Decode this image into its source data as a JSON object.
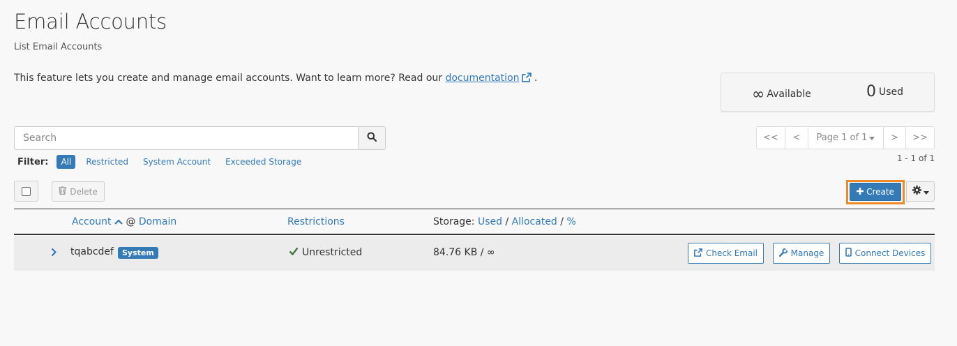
{
  "header": {
    "title": "Email Accounts",
    "subtitle": "List Email Accounts",
    "intro_text": "This feature lets you create and manage email accounts. Want to learn more? Read our ",
    "doc_link": "documentation",
    "intro_end": " ."
  },
  "stats": {
    "available_symbol": "∞",
    "available_label": "Available",
    "used_value": "0",
    "used_label": "Used"
  },
  "search": {
    "placeholder": "Search"
  },
  "filter": {
    "label": "Filter:",
    "items": [
      "All",
      "Restricted",
      "System Account",
      "Exceeded Storage"
    ],
    "active": "All"
  },
  "pagination": {
    "first": "<<",
    "prev": "<",
    "page_label": "Page 1 of 1",
    "next": ">",
    "last": ">>",
    "count": "1 - 1 of 1"
  },
  "toolbar": {
    "delete_label": "Delete",
    "create_label": "Create"
  },
  "table": {
    "headers": {
      "account": "Account",
      "at": "@",
      "domain": "Domain",
      "restrictions": "Restrictions",
      "storage_prefix": "Storage:",
      "used": "Used",
      "allocated": "Allocated",
      "percent": "%",
      "sep": "/"
    },
    "rows": [
      {
        "account": "tqabcdef",
        "badge": "System",
        "restrictions": "Unrestricted",
        "storage": "84.76 KB / ∞",
        "actions": [
          "Check Email",
          "Manage",
          "Connect Devices"
        ]
      }
    ]
  },
  "colors": {
    "primary": "#337ab7",
    "highlight": "#f08a24",
    "success": "#3c763d"
  }
}
